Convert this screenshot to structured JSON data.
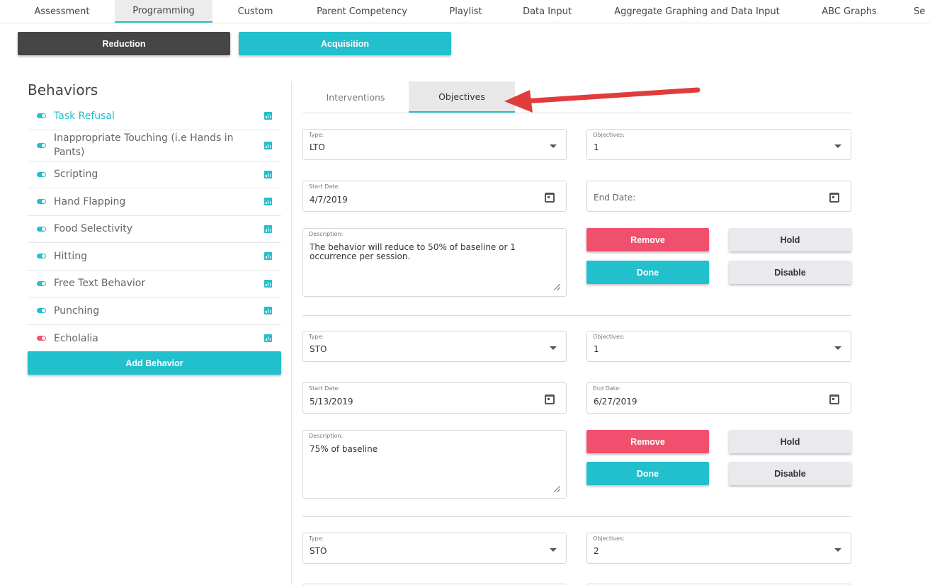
{
  "topnav": {
    "tabs": [
      {
        "label": "Assessment"
      },
      {
        "label": "Programming"
      },
      {
        "label": "Custom"
      },
      {
        "label": "Parent Competency"
      },
      {
        "label": "Playlist"
      },
      {
        "label": "Data Input"
      },
      {
        "label": "Aggregate Graphing and Data Input"
      },
      {
        "label": "ABC Graphs"
      },
      {
        "label": "Se"
      }
    ],
    "active": "Programming"
  },
  "mode": {
    "reduction_label": "Reduction",
    "acquisition_label": "Acquisition"
  },
  "behaviors": {
    "title": "Behaviors",
    "items": [
      {
        "label": "Task Refusal",
        "selected": true,
        "toggle_color": "#22bfcc"
      },
      {
        "label": "Inappropriate Touching (i.e Hands in Pants)",
        "selected": false,
        "toggle_color": "#22bfcc"
      },
      {
        "label": "Scripting",
        "selected": false,
        "toggle_color": "#22bfcc"
      },
      {
        "label": "Hand Flapping",
        "selected": false,
        "toggle_color": "#22bfcc"
      },
      {
        "label": "Food Selectivity",
        "selected": false,
        "toggle_color": "#22bfcc"
      },
      {
        "label": "Hitting",
        "selected": false,
        "toggle_color": "#22bfcc"
      },
      {
        "label": "Free Text Behavior",
        "selected": false,
        "toggle_color": "#22bfcc"
      },
      {
        "label": "Punching",
        "selected": false,
        "toggle_color": "#22bfcc"
      },
      {
        "label": "Echolalia",
        "selected": false,
        "toggle_color": "#f0506e"
      }
    ],
    "add_label": "Add Behavior"
  },
  "subtabs": {
    "interventions_label": "Interventions",
    "objectives_label": "Objectives",
    "active": "Objectives"
  },
  "objectives": [
    {
      "type_label": "Type:",
      "type_value": "LTO",
      "objectives_label": "Objectives:",
      "objectives_value": "1",
      "start_label": "Start Date:",
      "start_value": "4/7/2019",
      "end_label": "End Date:",
      "end_value": "",
      "desc_label": "Description:",
      "desc_value": "The behavior will reduce to 50% of baseline or 1 occurrence per session.",
      "remove_label": "Remove",
      "done_label": "Done",
      "hold_label": "Hold",
      "disable_label": "Disable"
    },
    {
      "type_label": "Type:",
      "type_value": "STO",
      "objectives_label": "Objectives:",
      "objectives_value": "1",
      "start_label": "Start Date:",
      "start_value": "5/13/2019",
      "end_label": "End Date:",
      "end_value": "6/27/2019",
      "desc_label": "Description:",
      "desc_value": "75% of baseline",
      "remove_label": "Remove",
      "done_label": "Done",
      "hold_label": "Hold",
      "disable_label": "Disable"
    },
    {
      "type_label": "Type:",
      "type_value": "STO",
      "objectives_label": "Objectives:",
      "objectives_value": "2"
    }
  ],
  "colors": {
    "accent": "#22bfcc",
    "danger": "#f0506e",
    "dark": "#464646",
    "annotation_arrow": "#e03c3c"
  }
}
